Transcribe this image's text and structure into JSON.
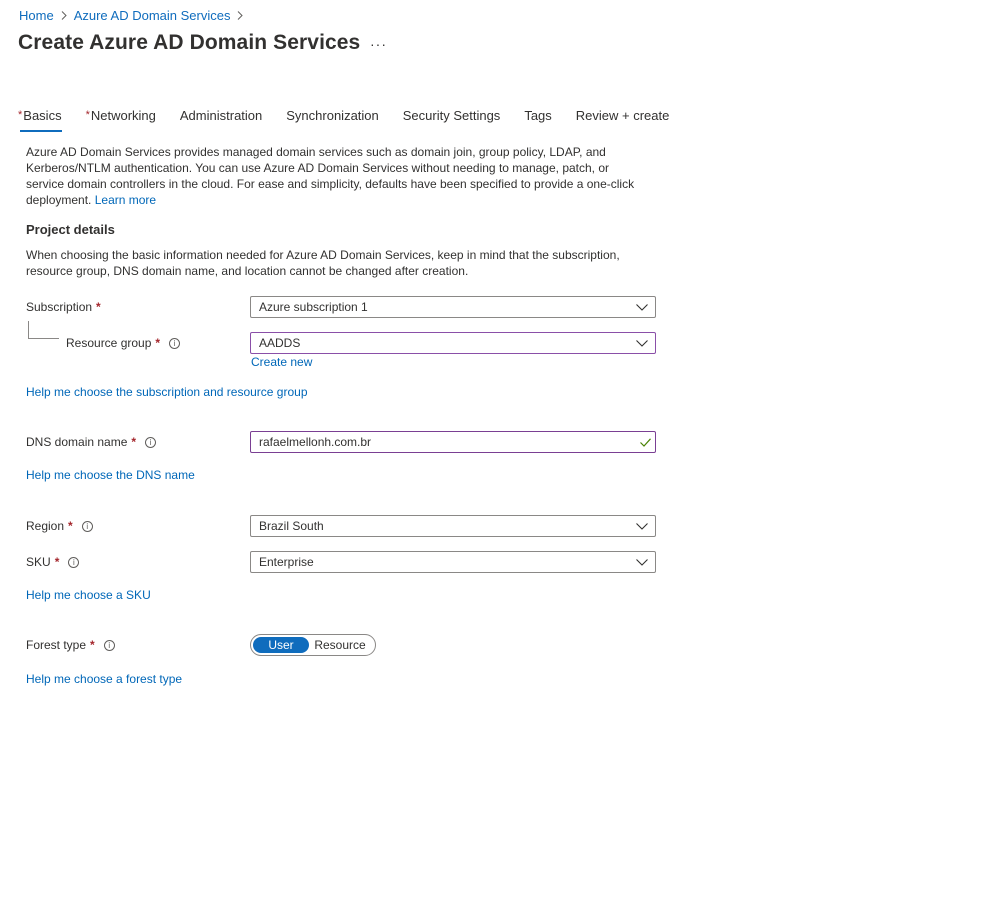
{
  "breadcrumb": {
    "home": "Home",
    "parent": "Azure AD Domain Services"
  },
  "page": {
    "title": "Create Azure AD Domain Services",
    "more": "···"
  },
  "tabs": [
    {
      "label": "Basics",
      "required": "*",
      "active": true
    },
    {
      "label": "Networking",
      "required": "*"
    },
    {
      "label": "Administration"
    },
    {
      "label": "Synchronization"
    },
    {
      "label": "Security Settings"
    },
    {
      "label": "Tags"
    },
    {
      "label": "Review + create"
    }
  ],
  "intro": {
    "text": "Azure AD Domain Services provides managed domain services such as domain join, group policy, LDAP, and Kerberos/NTLM authentication. You can use Azure AD Domain Services without needing to manage, patch, or service domain controllers in the cloud. For ease and simplicity, defaults have been specified to provide a one-click deployment.",
    "learn_more": "Learn more"
  },
  "project": {
    "title": "Project details",
    "desc": "When choosing the basic information needed for Azure AD Domain Services, keep in mind that the subscription, resource group, DNS domain name, and location cannot be changed after creation."
  },
  "form": {
    "subscription": {
      "label": "Subscription",
      "value": "Azure subscription 1"
    },
    "resource_group": {
      "label": "Resource group",
      "value": "AADDS",
      "create_new": "Create new"
    },
    "help_sub": "Help me choose the subscription and resource group",
    "dns": {
      "label": "DNS domain name",
      "value": "rafaelmellonh.com.br"
    },
    "help_dns": "Help me choose the DNS name",
    "region": {
      "label": "Region",
      "value": "Brazil South"
    },
    "sku": {
      "label": "SKU",
      "value": "Enterprise"
    },
    "help_sku": "Help me choose a SKU",
    "forest": {
      "label": "Forest type",
      "options": [
        "User",
        "Resource"
      ],
      "selected": "User"
    },
    "help_forest": "Help me choose a forest type"
  },
  "common": {
    "required_mark": "*",
    "info_glyph": "i"
  },
  "colors": {
    "accent": "#0f6cbd",
    "required": "#a4262c",
    "valid": "#498205"
  }
}
